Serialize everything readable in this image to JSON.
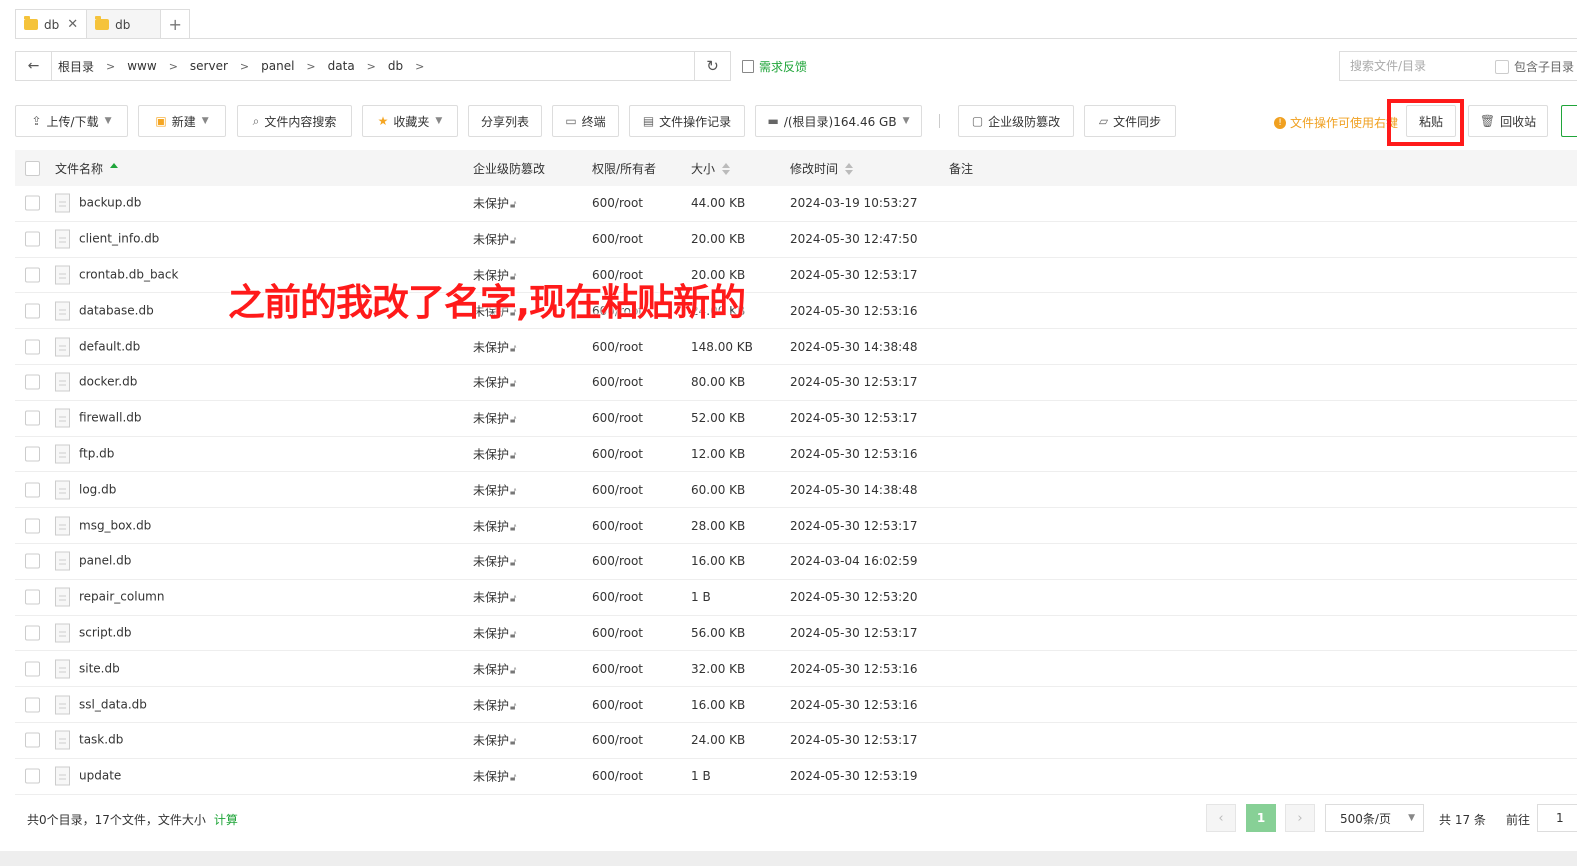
{
  "tabs": [
    {
      "label": "db",
      "active": true
    },
    {
      "label": "db",
      "active": false
    }
  ],
  "path": {
    "crumbs": [
      "根目录",
      "www",
      "server",
      "panel",
      "data",
      "db"
    ]
  },
  "feedback_label": "需求反馈",
  "search": {
    "placeholder": "搜索文件/目录",
    "subdir_label": "包含子目录"
  },
  "toolbar": {
    "upload_label": "上传/下载",
    "new_label": "新建",
    "content_search_label": "文件内容搜索",
    "favorites_label": "收藏夹",
    "share_list_label": "分享列表",
    "terminal_label": "终端",
    "oplog_label": "文件操作记录",
    "disk_label": "/(根目录)164.46 GB",
    "tamper_label": "企业级防篡改",
    "sync_label": "文件同步",
    "tip_text": "文件操作可使用右键",
    "paste_label": "粘贴",
    "recycle_label": "回收站"
  },
  "table": {
    "headers": {
      "name": "文件名称",
      "protect": "企业级防篡改",
      "perm": "权限/所有者",
      "size": "大小",
      "mtime": "修改时间",
      "note": "备注"
    },
    "rows": [
      {
        "name": "backup.db",
        "protect": "未保护",
        "perm": "600/root",
        "size": "44.00 KB",
        "mtime": "2024-03-19 10:53:27"
      },
      {
        "name": "client_info.db",
        "protect": "未保护",
        "perm": "600/root",
        "size": "20.00 KB",
        "mtime": "2024-05-30 12:47:50"
      },
      {
        "name": "crontab.db_back",
        "protect": "未保护",
        "perm": "600/root",
        "size": "20.00 KB",
        "mtime": "2024-05-30 12:53:17"
      },
      {
        "name": "database.db",
        "protect": "未保护",
        "perm": "600/root",
        "size": "24.00 KB",
        "mtime": "2024-05-30 12:53:16"
      },
      {
        "name": "default.db",
        "protect": "未保护",
        "perm": "600/root",
        "size": "148.00 KB",
        "mtime": "2024-05-30 14:38:48"
      },
      {
        "name": "docker.db",
        "protect": "未保护",
        "perm": "600/root",
        "size": "80.00 KB",
        "mtime": "2024-05-30 12:53:17"
      },
      {
        "name": "firewall.db",
        "protect": "未保护",
        "perm": "600/root",
        "size": "52.00 KB",
        "mtime": "2024-05-30 12:53:17"
      },
      {
        "name": "ftp.db",
        "protect": "未保护",
        "perm": "600/root",
        "size": "12.00 KB",
        "mtime": "2024-05-30 12:53:16"
      },
      {
        "name": "log.db",
        "protect": "未保护",
        "perm": "600/root",
        "size": "60.00 KB",
        "mtime": "2024-05-30 14:38:48"
      },
      {
        "name": "msg_box.db",
        "protect": "未保护",
        "perm": "600/root",
        "size": "28.00 KB",
        "mtime": "2024-05-30 12:53:17"
      },
      {
        "name": "panel.db",
        "protect": "未保护",
        "perm": "600/root",
        "size": "16.00 KB",
        "mtime": "2024-03-04 16:02:59"
      },
      {
        "name": "repair_column",
        "protect": "未保护",
        "perm": "600/root",
        "size": "1 B",
        "mtime": "2024-05-30 12:53:20"
      },
      {
        "name": "script.db",
        "protect": "未保护",
        "perm": "600/root",
        "size": "56.00 KB",
        "mtime": "2024-05-30 12:53:17"
      },
      {
        "name": "site.db",
        "protect": "未保护",
        "perm": "600/root",
        "size": "32.00 KB",
        "mtime": "2024-05-30 12:53:16"
      },
      {
        "name": "ssl_data.db",
        "protect": "未保护",
        "perm": "600/root",
        "size": "16.00 KB",
        "mtime": "2024-05-30 12:53:16"
      },
      {
        "name": "task.db",
        "protect": "未保护",
        "perm": "600/root",
        "size": "24.00 KB",
        "mtime": "2024-05-30 12:53:17"
      },
      {
        "name": "update",
        "protect": "未保护",
        "perm": "600/root",
        "size": "1 B",
        "mtime": "2024-05-30 12:53:19"
      }
    ]
  },
  "annotation_text": "之前的我改了名字,现在粘贴新的",
  "footer": {
    "summary": "共0个目录，17个文件，文件大小",
    "calc_label": "计算",
    "current_page": "1",
    "page_size": "500条/页",
    "total": "共 17 条",
    "goto_label": "前往",
    "goto_value": "1"
  },
  "colors": {
    "accent": "#20a53a",
    "highlight": "#ff1a1a",
    "tip": "#f0a020"
  }
}
